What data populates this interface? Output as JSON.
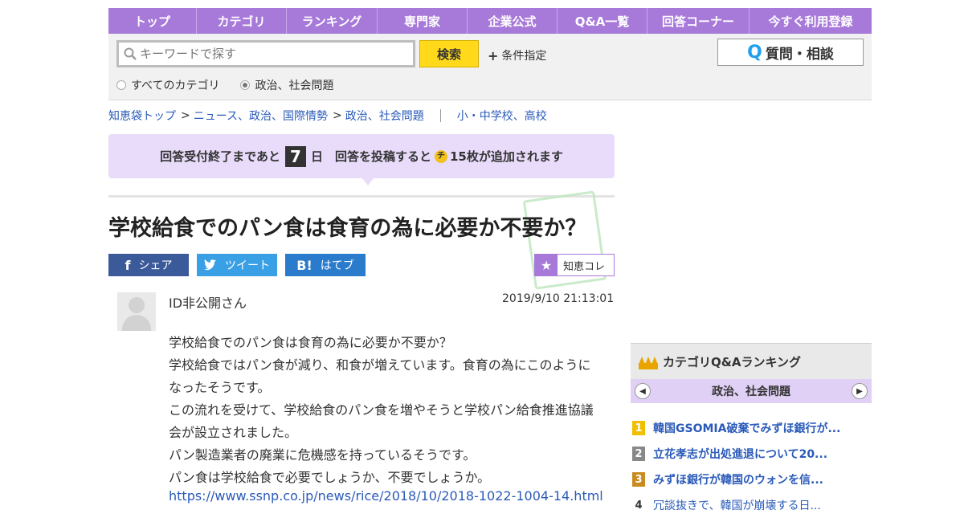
{
  "nav": [
    "トップ",
    "カテゴリ",
    "ランキング",
    "専門家",
    "企業公式",
    "Q&A一覧",
    "回答コーナー",
    "今すぐ利用登録"
  ],
  "search": {
    "placeholder": "キーワードで探す",
    "button": "検索",
    "conditions": "条件指定",
    "ask_button": "質問・相談",
    "radio_all": "すべてのカテゴリ",
    "radio_cat": "政治、社会問題"
  },
  "breadcrumb": {
    "home": "知恵袋トップ",
    "level1": "ニュース、政治、国際情勢",
    "level2": "政治、社会問題",
    "related": "小・中学校、高校"
  },
  "notice": {
    "before": "回答受付終了まであと",
    "days": "7",
    "after": "日　回答を投稿すると",
    "coin": "チ",
    "reward": "15枚が追加されます"
  },
  "question": {
    "title": "学校給食でのパン食は食育の為に必要か不要か？",
    "user": "ID非公開さん",
    "date": "2019/9/10  21:13:01",
    "body": [
      "学校給食でのパン食は食育の為に必要か不要か？",
      "学校給食ではパン食が減り、和食が増えています。食育の為にこのように",
      "なったそうです。",
      "この流れを受けて、学校給食のパン食を増やそうと学校パン給食推進協議",
      "会が設立されました。",
      "パン製造業者の廃業に危機感を持っているそうです。",
      "パン食は学校給食で必要でしょうか、不要でしょうか。"
    ],
    "link": "https://www.ssnp.co.jp/news/rice/2018/10/2018-1022-1004-14.html"
  },
  "share": {
    "fb": "シェア",
    "tw": "ツイート",
    "hb": "はてブ",
    "chie": "知恵コレ"
  },
  "ranking": {
    "title": "カテゴリQ&Aランキング",
    "category": "政治、社会問題",
    "items": [
      {
        "rank": "1",
        "text": "韓国GSOMIA破棄でみずほ銀行が..."
      },
      {
        "rank": "2",
        "text": "立花孝志が出処進退について20..."
      },
      {
        "rank": "3",
        "text": "みずほ銀行が韓国のウォンを信..."
      },
      {
        "rank": "4",
        "text": "冗談抜きで、韓国が崩壊する日..."
      }
    ]
  },
  "colors": {
    "nav": "#a779d9",
    "notice": "#e8dcfa",
    "link": "#2a5ab9",
    "search_btn": "#ffd91a"
  }
}
